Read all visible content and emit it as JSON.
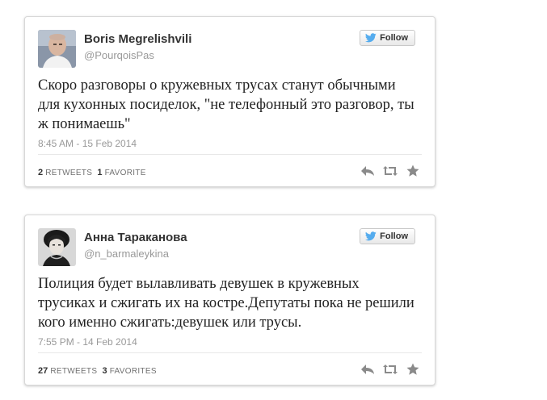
{
  "colors": {
    "name_text": "#333333",
    "secondary_text": "#999999",
    "follow_bird": "#55acee",
    "action_icon": "#8a8a8a"
  },
  "tweets": [
    {
      "author_name": "Boris Megrelishvili",
      "handle": "@PourqoisPas",
      "follow_label": "Follow",
      "text": "Скоро разговоры о кружевных трусах станут обычными для кухонных посиделок, \"не телефонный это разговор, ты ж понимаешь\"",
      "timestamp": "8:45 AM - 15 Feb 2014",
      "retweets_count": "2",
      "retweets_label": "RETWEETS",
      "favorites_count": "1",
      "favorites_label": "FAVORITE",
      "icons": [
        "reply-icon",
        "retweet-icon",
        "favorite-star-icon"
      ]
    },
    {
      "author_name": "Анна Тараканова",
      "handle": "@n_barmaleykina",
      "follow_label": "Follow",
      "text": "Полиция будет вылавливать девушек в кружевных трусиках и сжигать их на костре.Депутаты пока не решили кого именно сжигать:девушек или трусы.",
      "timestamp": "7:55 PM - 14 Feb 2014",
      "retweets_count": "27",
      "retweets_label": "RETWEETS",
      "favorites_count": "3",
      "favorites_label": "FAVORITES",
      "icons": [
        "reply-icon",
        "retweet-icon",
        "favorite-star-icon"
      ]
    }
  ]
}
